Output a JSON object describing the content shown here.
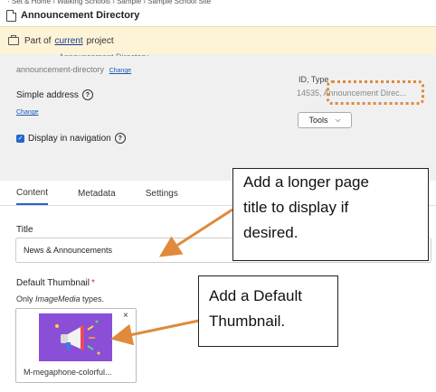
{
  "breadcrumb": "· Set & Home › Walking Schools › Sample › Sample School Site",
  "page": {
    "title": "Announcement Directory"
  },
  "banner": {
    "prefix": "Part of",
    "link": "current",
    "suffix": "project"
  },
  "properties": {
    "clipped_name": "Announcement Directory",
    "slug": "announcement-directory",
    "slug_change": "Change",
    "simple_address_label": "Simple address",
    "help_glyph": "?",
    "change_link": "Change",
    "display_in_navigation": "Display in navigation",
    "checkbox_glyph": "✓",
    "id_type_label": "ID, Type",
    "id_type_value": "14535, Announcement Direc...",
    "tools_label": "Tools",
    "chevron_glyph": "⌵"
  },
  "tabs": [
    {
      "label": "Content",
      "active": true
    },
    {
      "label": "Metadata",
      "active": false
    },
    {
      "label": "Settings",
      "active": false
    }
  ],
  "form": {
    "title_label": "Title",
    "title_value": "News & Announcements",
    "thumb_label": "Default Thumbnail",
    "required_mark": "*",
    "thumb_hint_prefix": "Only ",
    "thumb_hint_type": "ImageMedia",
    "thumb_hint_suffix": " types.",
    "thumb_name": "M-megaphone-colorful...",
    "close_glyph": "×"
  },
  "callouts": [
    {
      "lines": [
        "Add a longer page",
        "title to display if",
        "desired."
      ]
    },
    {
      "lines": [
        "Add a Default",
        "Thumbnail."
      ]
    }
  ],
  "colors": {
    "accent": "#e08a3c",
    "banner": "#fdf3d6",
    "tab_active": "#2a62c9",
    "thumb_bg": "#8a4fd6"
  }
}
